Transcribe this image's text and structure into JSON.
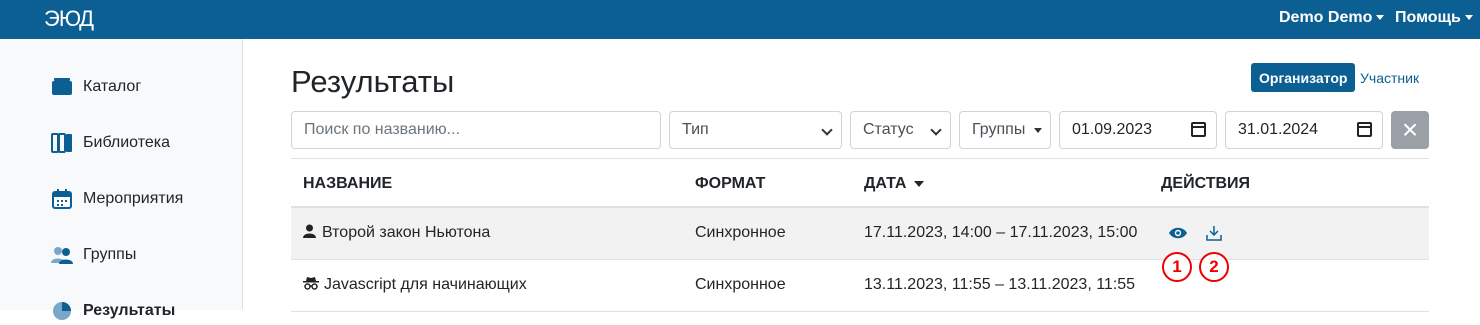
{
  "brand": {
    "logo_text": "ЭЮД"
  },
  "topnav": {
    "user": "Demo Demo",
    "help": "Помощь"
  },
  "sidebar": {
    "items": [
      {
        "label": "Каталог",
        "icon": "catalog-icon"
      },
      {
        "label": "Библиотека",
        "icon": "library-icon"
      },
      {
        "label": "Мероприятия",
        "icon": "calendar-icon"
      },
      {
        "label": "Группы",
        "icon": "groups-icon"
      },
      {
        "label": "Результаты",
        "icon": "results-icon"
      }
    ]
  },
  "page": {
    "title": "Результаты"
  },
  "role_toggle": {
    "organizer": "Организатор",
    "participant": "Участник"
  },
  "filters": {
    "search_placeholder": "Поиск по названию...",
    "type": "Тип",
    "status": "Статус",
    "groups": "Группы",
    "date_from": "01.09.2023",
    "date_to": "31.01.2024",
    "clear": "×"
  },
  "table": {
    "headers": {
      "name": "НАЗВАНИЕ",
      "format": "ФОРМАТ",
      "date": "ДАТА",
      "actions": "ДЕЙСТВИЯ"
    },
    "rows": [
      {
        "name": "Второй закон Ньютона",
        "format": "Синхронное",
        "date": "17.11.2023, 14:00 – 17.11.2023, 15:00",
        "icon": "person-icon"
      },
      {
        "name": "Javascript для начинающих",
        "format": "Синхронное",
        "date": "13.11.2023, 11:55 – 13.11.2023, 11:55",
        "icon": "incognito-icon"
      }
    ]
  },
  "annotations": {
    "marker1": "1",
    "marker2": "2"
  },
  "colors": {
    "brand": "#0b5f93",
    "marker": "#e00000"
  }
}
